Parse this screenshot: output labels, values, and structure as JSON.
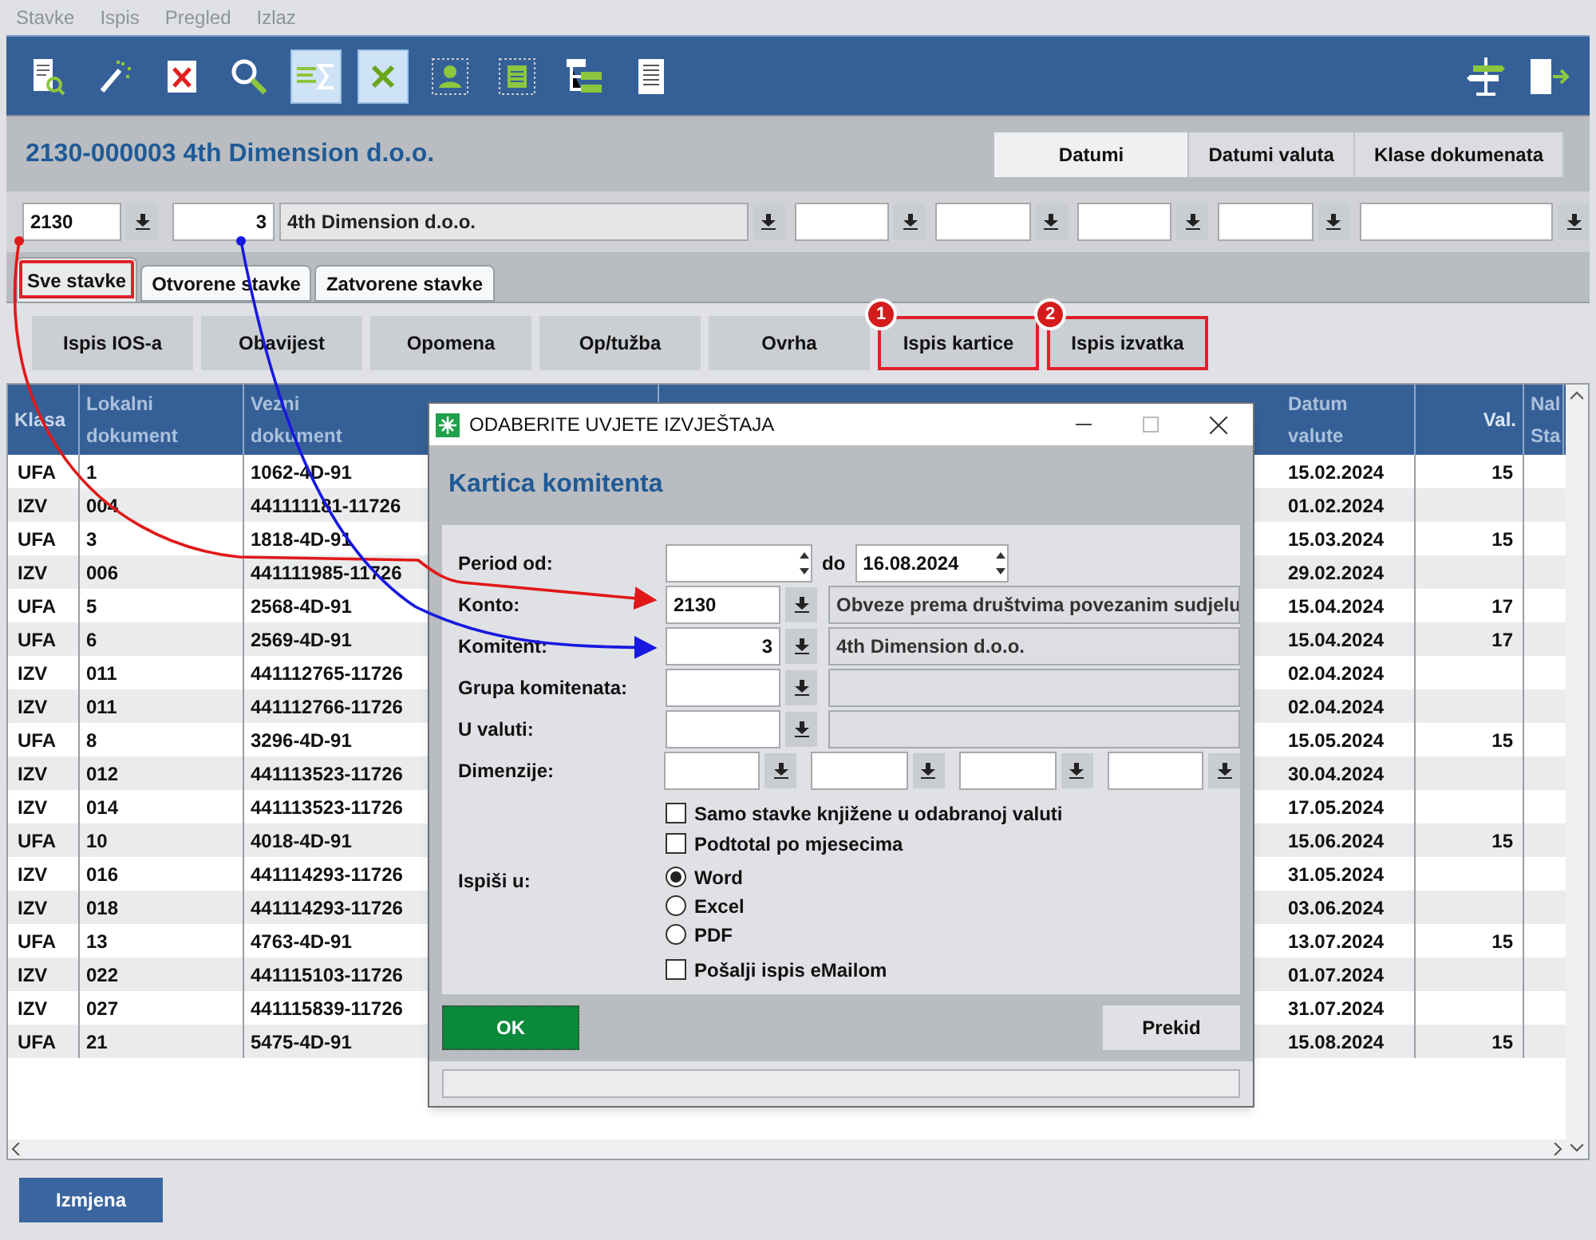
{
  "menu": [
    "Stavke",
    "Ispis",
    "Pregled",
    "Izlaz"
  ],
  "toolbar": [
    {
      "kind": "report",
      "pressed": false
    },
    {
      "kind": "wand",
      "pressed": false
    },
    {
      "kind": "delete",
      "pressed": false
    },
    {
      "kind": "search",
      "pressed": false
    },
    {
      "kind": "sum",
      "pressed": true
    },
    {
      "kind": "excel",
      "pressed": true
    },
    {
      "kind": "person",
      "pressed": false
    },
    {
      "kind": "panel",
      "pressed": false
    },
    {
      "kind": "tree",
      "pressed": false
    },
    {
      "kind": "document",
      "pressed": false
    }
  ],
  "toolbar_right": [
    {
      "kind": "signpost"
    },
    {
      "kind": "exit"
    }
  ],
  "header": {
    "title": "2130-000003 4th Dimension d.o.o.",
    "view_tabs": [
      {
        "label": "Datumi",
        "selected": true
      },
      {
        "label": "Datumi valuta",
        "selected": false
      },
      {
        "label": "Klase dokumenata",
        "selected": false
      }
    ]
  },
  "filter": {
    "konto": "2130",
    "komitent_code": "3",
    "komitent_name": "4th Dimension d.o.o."
  },
  "tabs": [
    {
      "label": "Sve stavke",
      "selected": true,
      "marked": true
    },
    {
      "label": "Otvorene stavke",
      "selected": false,
      "marked": false
    },
    {
      "label": "Zatvorene stavke",
      "selected": false,
      "marked": false
    }
  ],
  "actions": [
    {
      "label": "Ispis IOS-a",
      "marked": false
    },
    {
      "label": "Obavijest",
      "marked": false
    },
    {
      "label": "Opomena",
      "marked": false
    },
    {
      "label": "Op/tužba",
      "marked": false
    },
    {
      "label": "Ovrha",
      "marked": false
    },
    {
      "label": "Ispis kartice",
      "marked": true,
      "badge": "1"
    },
    {
      "label": "Ispis izvatka",
      "marked": true,
      "badge": "2"
    }
  ],
  "table": {
    "columns": [
      [
        "Klasa"
      ],
      [
        "Lokalni",
        "dokument"
      ],
      [
        "Vezni",
        "dokument"
      ],
      [
        "Datum",
        "valute"
      ],
      [
        "Val."
      ],
      [
        "Nal",
        "Sta"
      ]
    ],
    "rows": [
      {
        "klasa": "UFA",
        "lokalni": "1",
        "vezni": "1062-4D-91",
        "datum": "15.02.2024",
        "val": "15"
      },
      {
        "klasa": "IZV",
        "lokalni": "004",
        "vezni": "441111181-11726",
        "datum": "01.02.2024"
      },
      {
        "klasa": "UFA",
        "lokalni": "3",
        "vezni": "1818-4D-91",
        "datum": "15.03.2024",
        "val": "15"
      },
      {
        "klasa": "IZV",
        "lokalni": "006",
        "vezni": "441111985-11726",
        "datum": "29.02.2024"
      },
      {
        "klasa": "UFA",
        "lokalni": "5",
        "vezni": "2568-4D-91",
        "datum": "15.04.2024",
        "val": "17"
      },
      {
        "klasa": "UFA",
        "lokalni": "6",
        "vezni": "2569-4D-91",
        "datum": "15.04.2024",
        "val": "17"
      },
      {
        "klasa": "IZV",
        "lokalni": "011",
        "vezni": "441112765-11726",
        "datum": "02.04.2024"
      },
      {
        "klasa": "IZV",
        "lokalni": "011",
        "vezni": "441112766-11726",
        "datum": "02.04.2024"
      },
      {
        "klasa": "UFA",
        "lokalni": "8",
        "vezni": "3296-4D-91",
        "datum": "15.05.2024",
        "val": "15"
      },
      {
        "klasa": "IZV",
        "lokalni": "012",
        "vezni": "441113523-11726",
        "datum": "30.04.2024"
      },
      {
        "klasa": "IZV",
        "lokalni": "014",
        "vezni": "441113523-11726",
        "datum": "17.05.2024"
      },
      {
        "klasa": "UFA",
        "lokalni": "10",
        "vezni": "4018-4D-91",
        "datum": "15.06.2024",
        "val": "15"
      },
      {
        "klasa": "IZV",
        "lokalni": "016",
        "vezni": "441114293-11726",
        "datum": "31.05.2024"
      },
      {
        "klasa": "IZV",
        "lokalni": "018",
        "vezni": "441114293-11726",
        "datum": "03.06.2024"
      },
      {
        "klasa": "UFA",
        "lokalni": "13",
        "vezni": "4763-4D-91",
        "datum": "13.07.2024",
        "val": "15"
      },
      {
        "klasa": "IZV",
        "lokalni": "022",
        "vezni": "441115103-11726",
        "datum": "01.07.2024"
      },
      {
        "klasa": "IZV",
        "lokalni": "027",
        "vezni": "441115839-11726",
        "datum": "31.07.2024"
      },
      {
        "klasa": "UFA",
        "lokalni": "21",
        "vezni": "5475-4D-91",
        "datum": "15.08.2024",
        "val": "15"
      }
    ]
  },
  "dialog": {
    "title": "ODABERITE UVJETE IZVJEŠTAJA",
    "heading": "Kartica komitenta",
    "period_label": "Period od:",
    "period_to_label": "do",
    "period_to": "16.08.2024",
    "konto_label": "Konto:",
    "konto": "2130",
    "konto_desc": "Obveze prema društvima povezanim sudjelu",
    "komitent_label": "Komitent:",
    "komitent": "3",
    "komitent_desc": "4th Dimension d.o.o.",
    "grupa_label": "Grupa komitenata:",
    "valuta_label": "U valuti:",
    "dimenzije_label": "Dimenzije:",
    "checkboxes": [
      {
        "label": "Samo stavke knjižene u odabranoj valuti",
        "checked": false
      },
      {
        "label": "Podtotal po mjesecima",
        "checked": false
      }
    ],
    "output_label": "Ispiši u:",
    "radios": [
      {
        "label": "Word",
        "selected": true
      },
      {
        "label": "Excel",
        "selected": false
      },
      {
        "label": "PDF",
        "selected": false
      }
    ],
    "email": {
      "label": "Pošalji ispis eMailom",
      "checked": false
    },
    "ok": "OK",
    "cancel": "Prekid"
  },
  "bottom_button": "Izmjena"
}
